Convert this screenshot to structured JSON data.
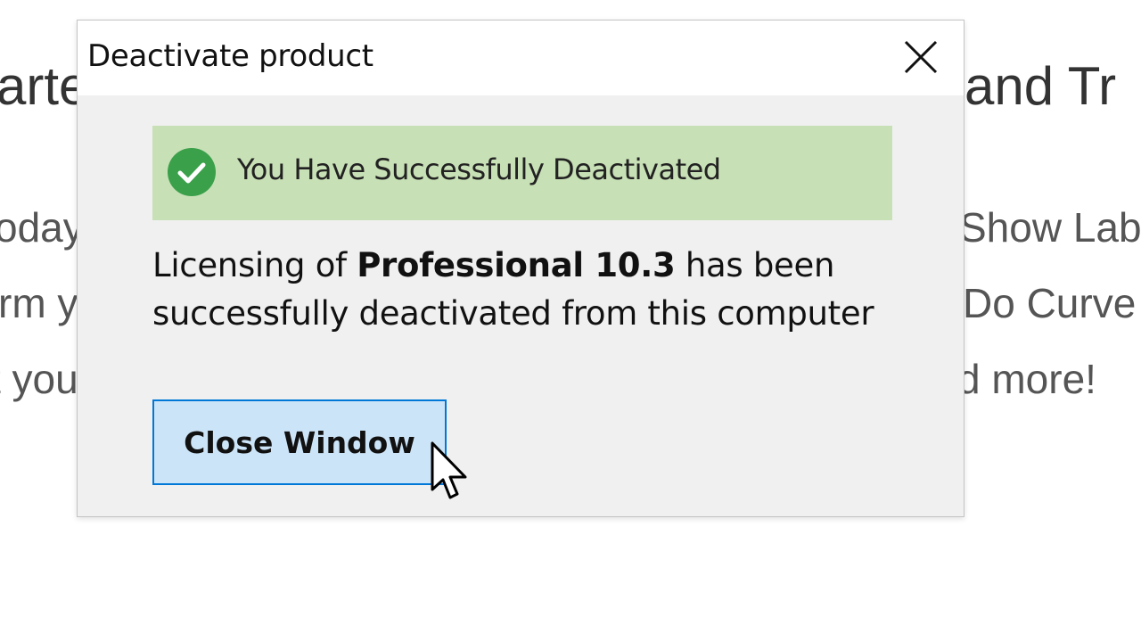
{
  "background_page": {
    "heading_left": "arte",
    "heading_right": "and Tr",
    "line1_left": "oday",
    "line1_right": "Show Lab",
    "line2_left": "rm y",
    "line2_right": "Do Curve",
    "line3_left": "t you",
    "line3_right": "d more!"
  },
  "dialog": {
    "title": "Deactivate product",
    "close_icon": "close-icon",
    "banner": {
      "icon": "check-circle-icon",
      "text": "You Have Successfully Deactivated",
      "color": "#c8e0b6",
      "icon_color": "#3aa04a"
    },
    "message": {
      "prefix": "Licensing of ",
      "product": "Professional 10.3",
      "suffix": " has been successfully deactivated from this computer"
    },
    "close_button_label": "Close Window",
    "accent": "#0078d7"
  }
}
